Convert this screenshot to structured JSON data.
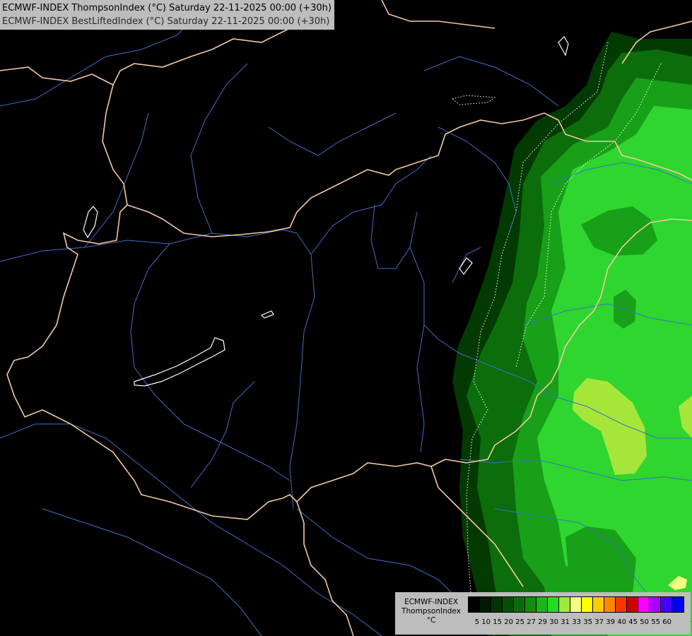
{
  "header": {
    "line1": "ECMWF-INDEX ThompsonIndex (°C) Saturday 22-11-2025 00:00 (+30h)",
    "line2": "ECMWF-INDEX BestLiftedIndex (°C) Saturday 22-11-2025 00:00 (+30h)"
  },
  "legend": {
    "label_line1": "ECMWF-INDEX",
    "label_line2": "ThompsonIndex",
    "label_line3": "°C",
    "ticks": [
      "5",
      "10",
      "15",
      "20",
      "25",
      "27",
      "29",
      "30",
      "31",
      "33",
      "35",
      "37",
      "39",
      "40",
      "45",
      "50",
      "55",
      "60"
    ],
    "colors": [
      "#000000",
      "#011a01",
      "#023402",
      "#064e06",
      "#0a6b0a",
      "#118c11",
      "#1bb51b",
      "#22dd22",
      "#9eea3a",
      "#f4ff80",
      "#ffff00",
      "#ffcc00",
      "#ff8800",
      "#ff3300",
      "#cc0000",
      "#ff00ff",
      "#aa00ff",
      "#4400ff",
      "#0000ff"
    ]
  },
  "map_colors": {
    "background": "#000000",
    "border": "#f3c9a0",
    "river": "#3f6fc5",
    "lake_outline": "#ffffff",
    "zone_1": "#023a02",
    "zone_2": "#0b6e0b",
    "zone_3": "#18a018",
    "zone_4": "#2fd62f",
    "zone_5": "#a6e63a",
    "zone_6": "#f4ff80"
  }
}
